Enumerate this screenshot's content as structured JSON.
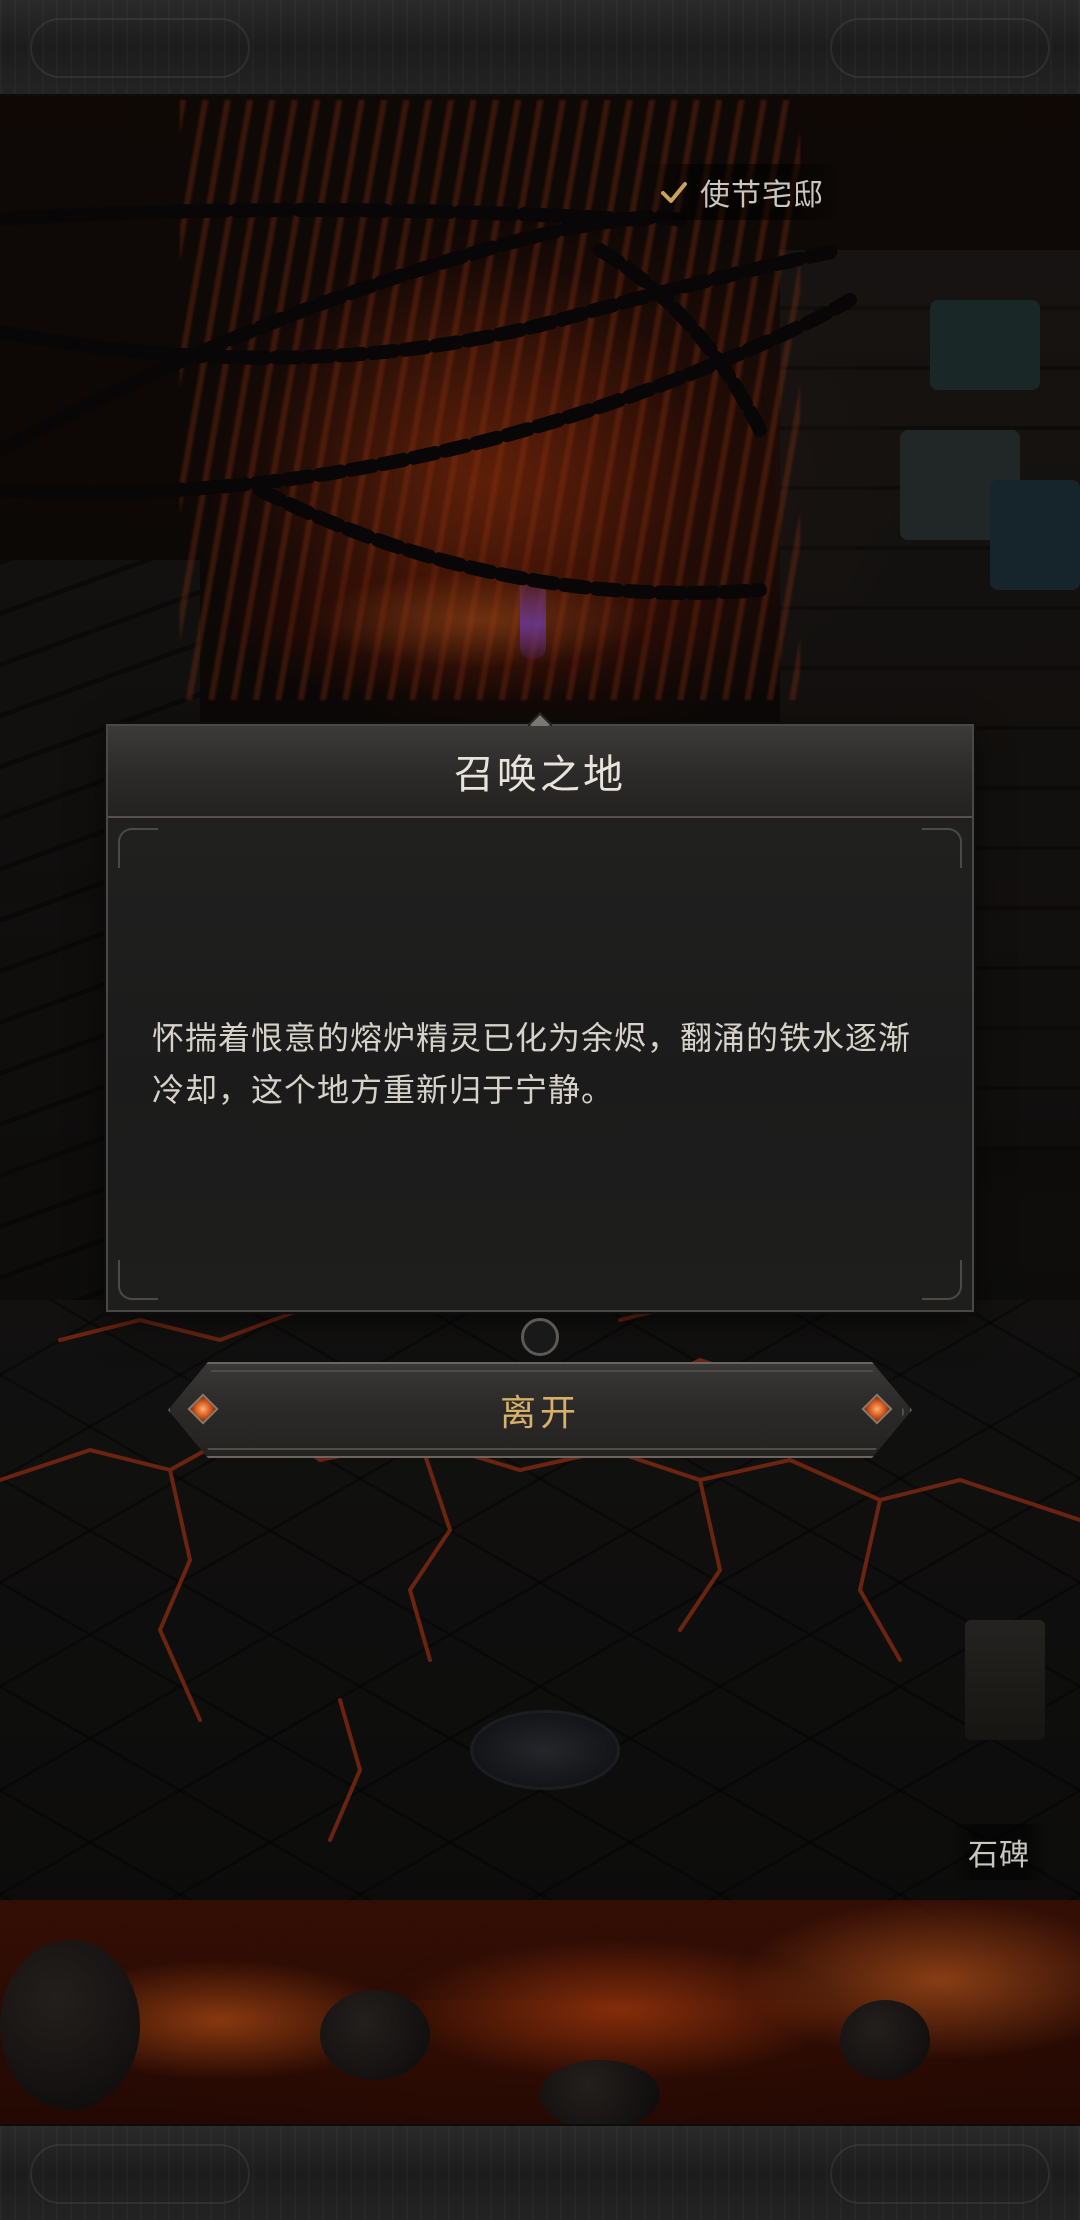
{
  "map_labels": {
    "envoy_mansion": "使节宅邸",
    "stone_stele": "石碑"
  },
  "dialog": {
    "title": "召唤之地",
    "body": "怀揣着恨意的熔炉精灵已化为余烬，翻涌的铁水逐渐冷却，这个地方重新归于宁静。"
  },
  "actions": {
    "leave_label": "离开"
  },
  "colors": {
    "accent_gold": "#d8b06a",
    "lava": "#e05a1c",
    "panel": "#1b1b1b"
  },
  "icons": {
    "mansion_marker": "check-icon",
    "button_ornament": "diamond-gem-icon"
  }
}
